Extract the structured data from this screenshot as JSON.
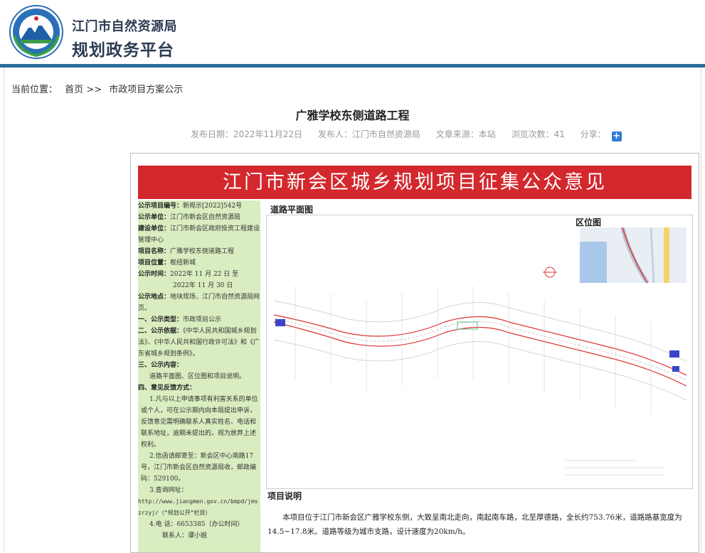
{
  "header": {
    "logo_icon": "mountain-emblem-icon",
    "site_name": "江门市自然资源局",
    "site_subtitle": "规划政务平台",
    "accent_color": "#2c6d9c"
  },
  "breadcrumb": {
    "label": "当前位置：",
    "home": "首页",
    "separator": ">>",
    "current": "市政项目方案公示"
  },
  "article": {
    "title": "广雅学校东侧道路工程",
    "meta": {
      "date": "发布日期：2022年11月22日",
      "publisher": "发布人：江门市自然资源局",
      "source": "文章来源：本站",
      "views": "浏览次数：41",
      "share": "分享："
    }
  },
  "poster": {
    "banner": "江门市新会区城乡规划项目征集公众意见",
    "banner_color": "#d3282d",
    "info_bg_color": "#d9edc0",
    "info": {
      "project_no": {
        "label": "公示项目编号：",
        "value": "新规示[2022]542号"
      },
      "unit": {
        "label": "公示单位：",
        "value": "江门市新会区自然资源局"
      },
      "builder": {
        "label": "建设单位：",
        "value": "江门市新会区政府投资工程建设管理中心"
      },
      "name": {
        "label": "项目名称：",
        "value": "广雅学校东侧道路工程"
      },
      "location": {
        "label": "项目位置：",
        "value": "枢纽新城"
      },
      "time": {
        "label": "公示时间：",
        "value": "2022年 11 月 22 日  至",
        "value2": "2022年 11 月 30 日"
      },
      "place": {
        "label": "公示地点：",
        "value": "地块现场、江门市自然资源局网页。"
      },
      "sec1": {
        "label": "一、公示类型：",
        "value": "市政项目公示"
      },
      "sec2": {
        "label": "二、公示依据：",
        "value": "《中华人民共和国城乡规划法》、《中华人民共和国行政许可法》和《广东省城乡规划条例》。"
      },
      "sec3": {
        "label": "三、公示内容：",
        "value": "道路平面图、区位图和项目说明。"
      },
      "sec4": {
        "label": "四、意见反馈方式："
      },
      "fb1": "1.凡与以上申请事项有利害关系的单位或个人，可在公示期内向本局提出申诉，反馈意见需明确联系人真实姓名、电话和联系地址，逾期未提出的，视为放弃上述权利。",
      "fb2": "2.信函请邮寄至：新会区中心南路17号，江门市新会区自然资源局收，邮政编码：529100。",
      "fb3_label": "3.查询网址：",
      "fb3_url": "http://www.jiangmen.gov.cn/bmpd/jmszrzyj/（“规划公开”栏目）",
      "fb4_phone": "4.电   话：6653385（办公时间）",
      "fb4_contact": "联系人：谭小姐"
    },
    "map_title": "道路平面图",
    "location_title": "区位图",
    "desc_title": "项目说明",
    "desc": "本项目位于江门市新会区广雅学校东侧，大致呈南北走向，南起南车路，北至厚德路，全长约753.76米，道路路基宽度为14.5~17.8米。道路等级为城市支路，设计速度为20km/h。"
  }
}
